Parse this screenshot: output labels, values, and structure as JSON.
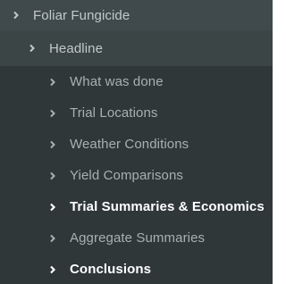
{
  "colors": {
    "level0_background": "#404a4c",
    "level1_background": "#3b4546",
    "level2_background": "#2f3739",
    "muted_text": "#a8b0b0",
    "active_text": "#ffffff"
  },
  "nav": {
    "root": {
      "label": "Foliar Fungicide",
      "icon": "chevron-right-icon"
    },
    "section": {
      "label": "Headline",
      "icon": "chevron-right-icon"
    },
    "items": [
      {
        "label": "What was done",
        "icon": "chevron-right-icon",
        "active": false
      },
      {
        "label": "Trial Locations",
        "icon": "chevron-right-icon",
        "active": false
      },
      {
        "label": "Weather Conditions",
        "icon": "chevron-right-icon",
        "active": false
      },
      {
        "label": "Yield Comparisons",
        "icon": "chevron-right-icon",
        "active": false
      },
      {
        "label": "Trial Summaries & Economics",
        "icon": "chevron-right-icon",
        "active": true
      },
      {
        "label": "Aggregate Summaries",
        "icon": "chevron-right-icon",
        "active": false
      },
      {
        "label": "Conclusions",
        "icon": "chevron-right-icon",
        "active": true
      }
    ]
  }
}
